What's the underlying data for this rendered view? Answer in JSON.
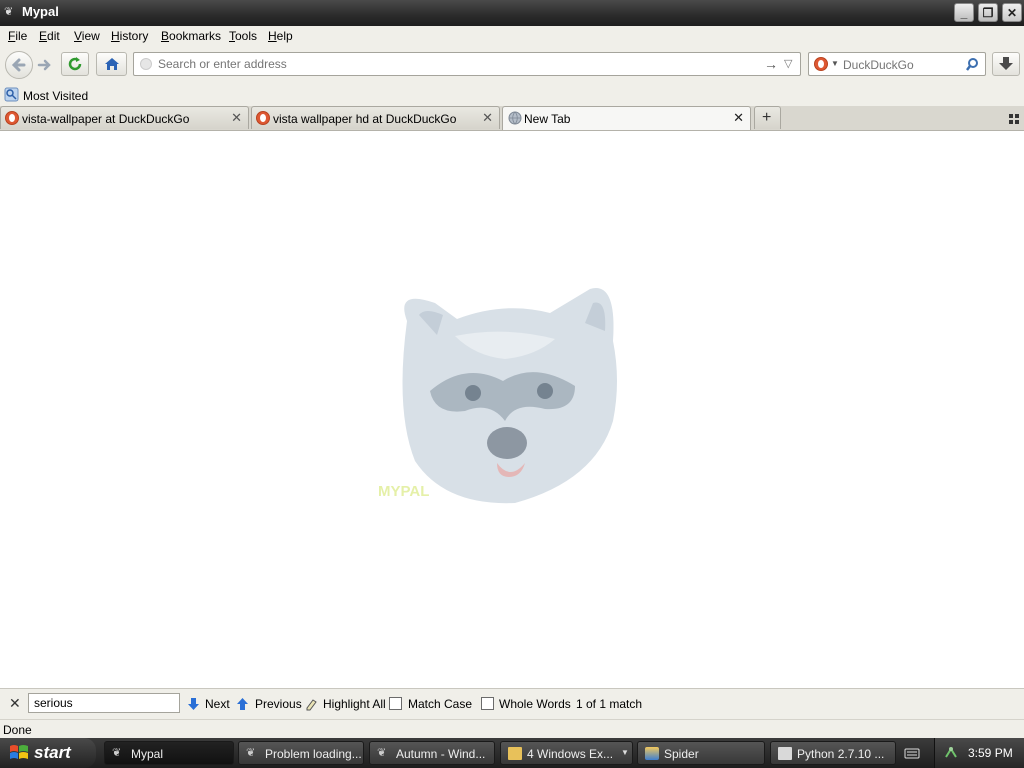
{
  "window": {
    "title": "Mypal"
  },
  "menu": [
    {
      "label": "File",
      "u": "F",
      "rest": "ile"
    },
    {
      "label": "Edit",
      "u": "E",
      "rest": "dit"
    },
    {
      "label": "View",
      "u": "V",
      "rest": "iew"
    },
    {
      "label": "History",
      "u": "H",
      "rest": "istory"
    },
    {
      "label": "Bookmarks",
      "u": "B",
      "rest": "ookmarks"
    },
    {
      "label": "Tools",
      "u": "T",
      "rest": "ools"
    },
    {
      "label": "Help",
      "u": "H",
      "rest": "elp"
    }
  ],
  "navbar": {
    "address_placeholder": "Search or enter address",
    "search_engine": "DuckDuckGo"
  },
  "bookmarks": {
    "most_visited": "Most Visited"
  },
  "tabs": [
    {
      "title": "vista-wallpaper at DuckDuckGo",
      "active": false
    },
    {
      "title": "vista wallpaper hd at DuckDuckGo",
      "active": false
    },
    {
      "title": "New Tab",
      "active": true
    }
  ],
  "content": {
    "logo_text": "MYPAL"
  },
  "findbar": {
    "query": "serious",
    "next": "Next",
    "previous": "Previous",
    "highlight_all": "Highlight All",
    "match_case": "Match Case",
    "match_case_checked": false,
    "whole_words": "Whole Words",
    "whole_words_checked": false,
    "result": "1 of 1 match"
  },
  "status": {
    "text": "Done"
  },
  "taskbar": {
    "start": "start",
    "tasks": [
      {
        "label": "Mypal",
        "active": true
      },
      {
        "label": "Problem loading...",
        "active": false
      },
      {
        "label": "Autumn - Wind...",
        "active": false
      },
      {
        "label": "4 Windows Ex...",
        "active": false
      },
      {
        "label": "Spider",
        "active": false
      },
      {
        "label": "Python 2.7.10 ...",
        "active": false
      }
    ],
    "clock": "3:59 PM"
  },
  "colors": {
    "ddg_orange": "#de5833",
    "accent_blue": "#2a6fd6",
    "green_reload": "#2f9a2f"
  }
}
